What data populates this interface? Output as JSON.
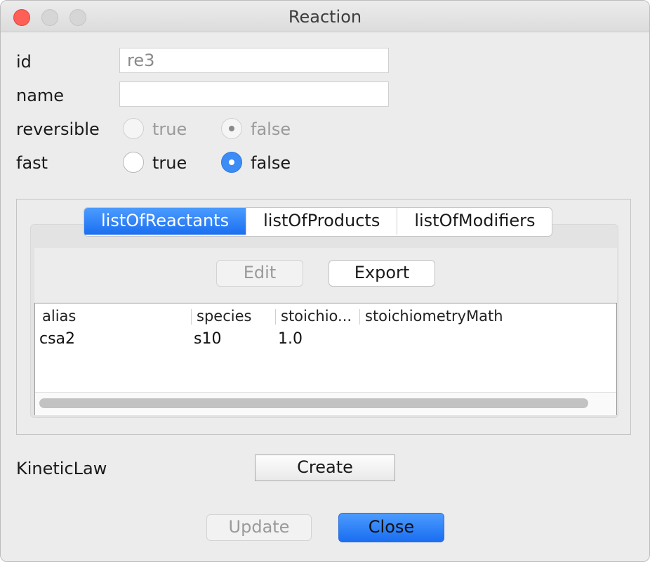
{
  "window": {
    "title": "Reaction"
  },
  "form": {
    "id_label": "id",
    "id_value": "re3",
    "name_label": "name",
    "name_value": "",
    "reversible_label": "reversible",
    "fast_label": "fast",
    "true_label": "true",
    "false_label": "false"
  },
  "tabs": [
    "listOfReactants",
    "listOfProducts",
    "listOfModifiers"
  ],
  "toolbar": {
    "edit_label": "Edit",
    "export_label": "Export"
  },
  "table": {
    "columns": [
      "alias",
      "species",
      "stoichio...",
      "stoichiometryMath"
    ],
    "rows": [
      {
        "alias": "csa2",
        "species": "s10",
        "stoich": "1.0",
        "math": ""
      }
    ]
  },
  "kinetic": {
    "label": "KineticLaw",
    "create_label": "Create"
  },
  "footer": {
    "update_label": "Update",
    "close_label": "Close"
  },
  "colors": {
    "accent": "#1b6ff0",
    "close_red": "#fe5f57"
  }
}
